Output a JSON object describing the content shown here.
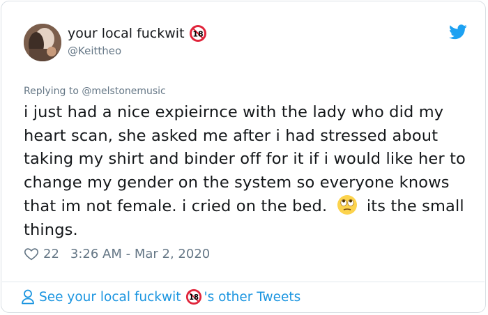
{
  "author": {
    "display_name": "your local fuckwit",
    "handle": "@Keittheo",
    "badge_icon": "adults-only-18-icon",
    "badge_text": "18"
  },
  "reply": {
    "prefix": "Replying to ",
    "mention": "@melstonemusic"
  },
  "tweet": {
    "text_before_emoji": "i just had a nice expieirnce with the lady who did my heart scan, she asked me after i had stressed about taking my shirt and binder off for it if i would like her to change my gender on the system so everyone knows that im not female. i cried on the bed.",
    "emoji": "face-with-rolling-eyes-emoji",
    "text_after_emoji": "its the small things."
  },
  "meta": {
    "likes": "22",
    "timestamp": "3:26 AM - Mar 2, 2020"
  },
  "footer": {
    "prefix": "See your local fuckwit",
    "suffix": "'s other Tweets"
  },
  "colors": {
    "link": "#1b95e0",
    "secondary_text": "#657786",
    "badge_red": "#e0243a",
    "twitter_blue": "#1da1f2"
  }
}
